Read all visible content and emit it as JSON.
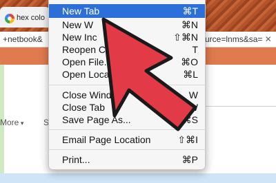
{
  "browser": {
    "tab_title": "hex colo",
    "url_left": "+netbook&",
    "url_right": "urce=lnms&sa=",
    "more_label": "More",
    "s_label": "S"
  },
  "menu": {
    "items": [
      {
        "label": "New Tab",
        "shortcut": "⌘T",
        "highlighted": true
      },
      {
        "label": "New W",
        "shortcut": "⌘N"
      },
      {
        "label": "New Inc",
        "shortcut": "⇧⌘N"
      },
      {
        "label": "Reopen C",
        "shortcut": "T"
      },
      {
        "label": "Open File...",
        "shortcut": "⌘O"
      },
      {
        "label": "Open Locati",
        "shortcut": "⌘L"
      },
      {
        "label": "Close Window",
        "shortcut": "W"
      },
      {
        "label": "Close Tab",
        "shortcut": "⌘W"
      },
      {
        "label": "Save Page As...",
        "shortcut": "⌘S"
      },
      {
        "label": "Email Page Location",
        "shortcut": "⇧⌘I"
      },
      {
        "label": "Print...",
        "shortcut": "⌘P"
      }
    ]
  },
  "colors": {
    "arrow": "#e23a47",
    "highlight": "#2d6fd9"
  }
}
